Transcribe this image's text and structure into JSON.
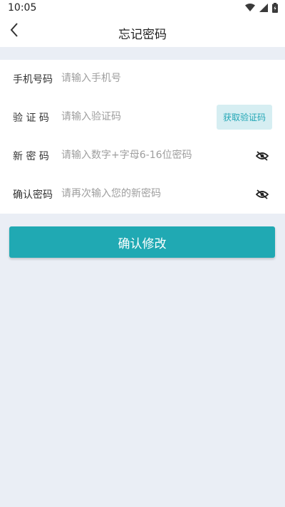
{
  "status_bar": {
    "time": "10:05",
    "icons": [
      "wifi-icon",
      "signal-icon",
      "battery-icon"
    ]
  },
  "app_bar": {
    "back_icon": "chevron-left-icon",
    "title": "忘记密码"
  },
  "form": {
    "phone": {
      "label": "手机号码",
      "placeholder": "请输入手机号",
      "value": ""
    },
    "code": {
      "label": "验 证 码",
      "placeholder": "请输入验证码",
      "value": "",
      "button_label": "获取验证码"
    },
    "new_password": {
      "label": "新 密 码",
      "placeholder": "请输入数字+字母6-16位密码",
      "value": "",
      "toggle_icon": "eye-off-icon"
    },
    "confirm_password": {
      "label": "确认密码",
      "placeholder": "请再次输入您的新密码",
      "value": "",
      "toggle_icon": "eye-off-icon"
    }
  },
  "submit": {
    "label": "确认修改"
  },
  "colors": {
    "accent": "#20a9b3",
    "code_button_bg": "#d6eef2",
    "code_button_text": "#22a6b5",
    "page_bg": "#eaeef5"
  }
}
